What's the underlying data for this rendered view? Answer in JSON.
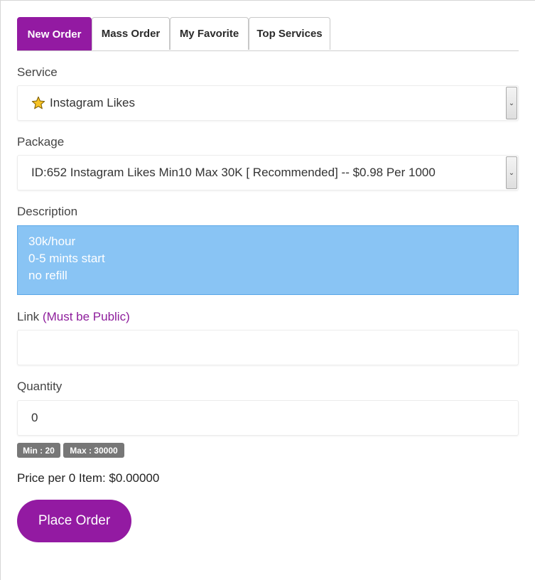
{
  "tabs": [
    {
      "label": "New Order",
      "active": true
    },
    {
      "label": "Mass Order",
      "active": false
    },
    {
      "label": "My Favorite",
      "active": false
    },
    {
      "label": "Top Services",
      "active": false
    }
  ],
  "service": {
    "label": "Service",
    "selected": "Instagram Likes",
    "icon": "star-icon"
  },
  "package": {
    "label": "Package",
    "selected": "ID:652 Instagram Likes Min10 Max 30K [ Recommended] -- $0.98 Per 1000"
  },
  "description": {
    "label": "Description",
    "lines": [
      "30k/hour",
      "0-5 mints start",
      "no refill"
    ]
  },
  "link": {
    "label": "Link",
    "note": "(Must be Public)",
    "value": ""
  },
  "quantity": {
    "label": "Quantity",
    "value": "0",
    "min_badge": "Min : 20",
    "max_badge": "Max : 30000"
  },
  "price_text": "Price per 0 Item: $0.00000",
  "place_order_label": "Place Order",
  "colors": {
    "accent": "#931aa2",
    "description_bg": "#89c4f4",
    "badge_bg": "#777777"
  }
}
